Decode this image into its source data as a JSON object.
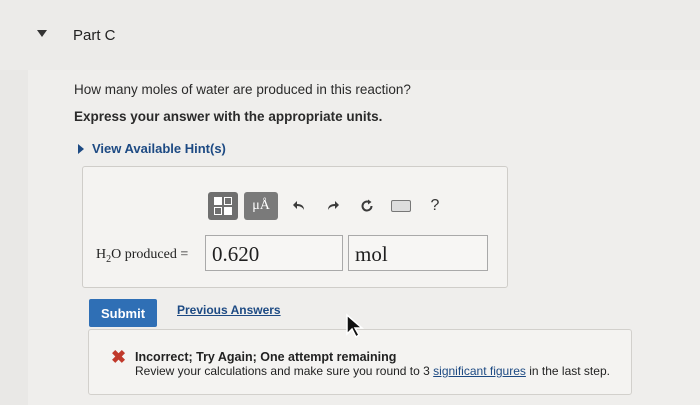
{
  "part": {
    "title": "Part C"
  },
  "question": {
    "text": "How many moles of water are produced in this reaction?",
    "instruction": "Express your answer with the appropriate units.",
    "hint_label": "View Available Hint(s)"
  },
  "toolbar": {
    "units_label": "μÅ",
    "help_label": "?",
    "icons": [
      "templates-icon",
      "units-icon",
      "undo-icon",
      "redo-icon",
      "reset-icon",
      "keyboard-icon",
      "help-icon"
    ]
  },
  "answer": {
    "label_prefix": "H",
    "label_sub": "2",
    "label_suffix": "O produced =",
    "value": "0.620",
    "unit": "mol"
  },
  "actions": {
    "submit_label": "Submit",
    "previous_label": "Previous Answers"
  },
  "feedback": {
    "title": "Incorrect; Try Again; One attempt remaining",
    "message_before": "Review your calculations and make sure you round to 3",
    "link_text": "significant figures",
    "message_after": "in the last step.",
    "status_color": "#c0392b"
  },
  "colors": {
    "accent": "#2f6fb5",
    "link": "#1d4a83",
    "error": "#c0392b"
  }
}
